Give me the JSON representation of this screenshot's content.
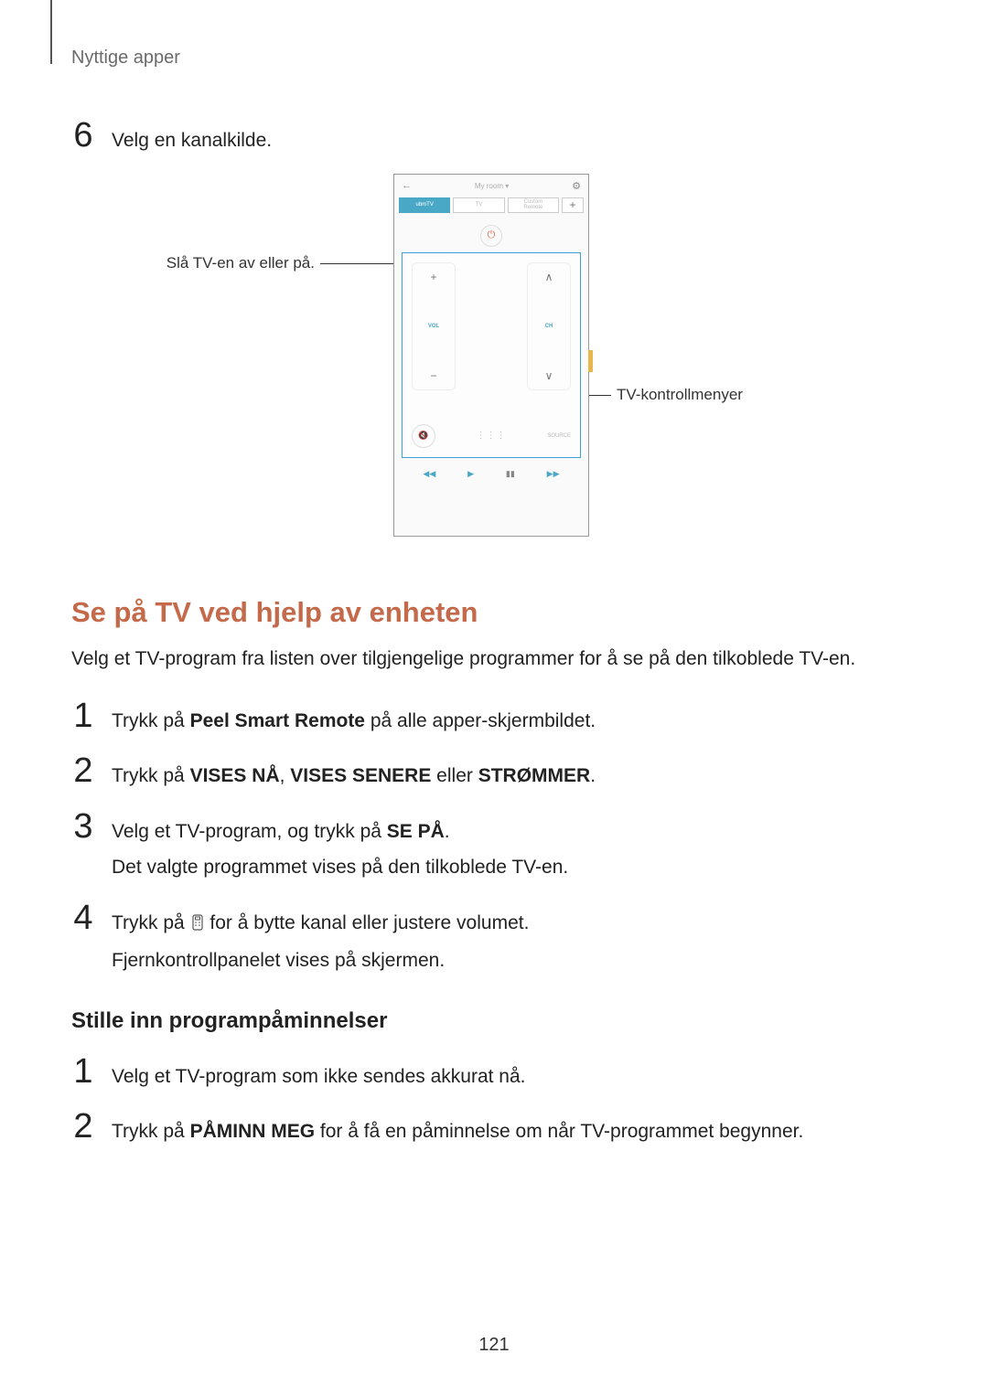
{
  "breadcrumb": "Nyttige apper",
  "step6": {
    "num": "6",
    "text": "Velg en kanalkilde."
  },
  "callout_left": "Slå TV-en av eller på.",
  "callout_right": "TV-kontrollmenyer",
  "phone": {
    "room": "My room",
    "tabs": {
      "t1": "ubmTV",
      "t2": "TV",
      "t3a": "Custom",
      "t3b": "Remote",
      "plus": "+"
    },
    "vol_label": "VOL",
    "ch_label": "CH",
    "source": "SOURCE"
  },
  "h2": "Se på TV ved hjelp av enheten",
  "intro": "Velg et TV-program fra listen over tilgjengelige programmer for å se på den tilkoblede TV-en.",
  "s1": {
    "num": "1",
    "pre": "Trykk på ",
    "bold": "Peel Smart Remote",
    "post": " på alle apper-skjermbildet."
  },
  "s2": {
    "num": "2",
    "pre": "Trykk på ",
    "b1": "VISES NÅ",
    "sep1": ", ",
    "b2": "VISES SENERE",
    "sep2": " eller ",
    "b3": "STRØMMER",
    "post": "."
  },
  "s3": {
    "num": "3",
    "l1_pre": "Velg et TV-program, og trykk på ",
    "l1_bold": "SE PÅ",
    "l1_post": ".",
    "l2": "Det valgte programmet vises på den tilkoblede TV-en."
  },
  "s4": {
    "num": "4",
    "l1_pre": "Trykk på ",
    "l1_post": " for å bytte kanal eller justere volumet.",
    "l2": "Fjernkontrollpanelet vises på skjermen."
  },
  "h3": "Stille inn programpåminnelser",
  "r1": {
    "num": "1",
    "text": "Velg et TV-program som ikke sendes akkurat nå."
  },
  "r2": {
    "num": "2",
    "pre": "Trykk på ",
    "bold": "PÅMINN MEG",
    "post": " for å få en påminnelse om når TV-programmet begynner."
  },
  "pagenum": "121"
}
